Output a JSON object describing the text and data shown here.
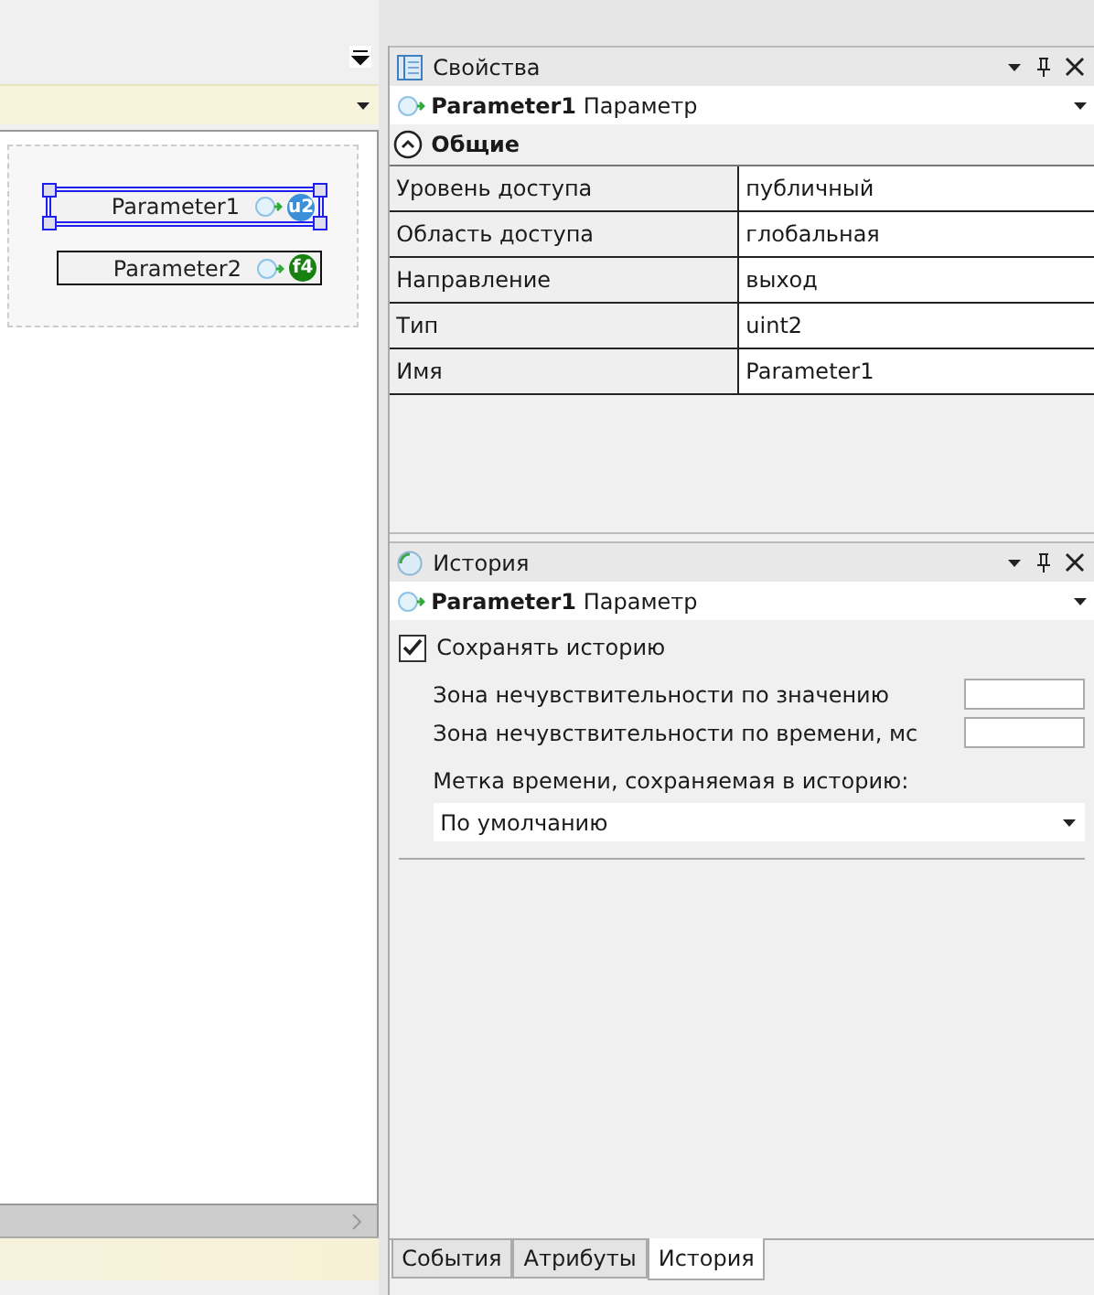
{
  "nodes": [
    {
      "label": "Parameter1",
      "badge": "u2",
      "color": "#3a8fd8",
      "selected": true
    },
    {
      "label": "Parameter2",
      "badge": "f4",
      "color": "#17820f",
      "selected": false
    }
  ],
  "properties": {
    "title": "Свойства",
    "object": {
      "name": "Parameter1",
      "type": "Параметр"
    },
    "group": {
      "label": "Общие",
      "expanded": true
    },
    "rows": [
      {
        "name": "Уровень доступа",
        "value": "публичный"
      },
      {
        "name": "Область доступа",
        "value": "глобальная"
      },
      {
        "name": "Направление",
        "value": "выход"
      },
      {
        "name": "Тип",
        "value": "uint2"
      },
      {
        "name": "Имя",
        "value": "Parameter1"
      }
    ]
  },
  "history": {
    "title": "История",
    "object": {
      "name": "Parameter1",
      "type": "Параметр"
    },
    "save_history": {
      "label": "Сохранять историю",
      "checked": true
    },
    "fields": [
      {
        "label": "Зона нечувствительности по значению"
      },
      {
        "label": "Зона нечувствительности по времени, мс"
      }
    ],
    "timestamp": {
      "label": "Метка времени, сохраняемая в историю:",
      "value": "По умолчанию"
    }
  },
  "tabs": [
    {
      "label": "События",
      "selected": false
    },
    {
      "label": "Атрибуты",
      "selected": false
    },
    {
      "label": "История",
      "selected": true
    }
  ]
}
